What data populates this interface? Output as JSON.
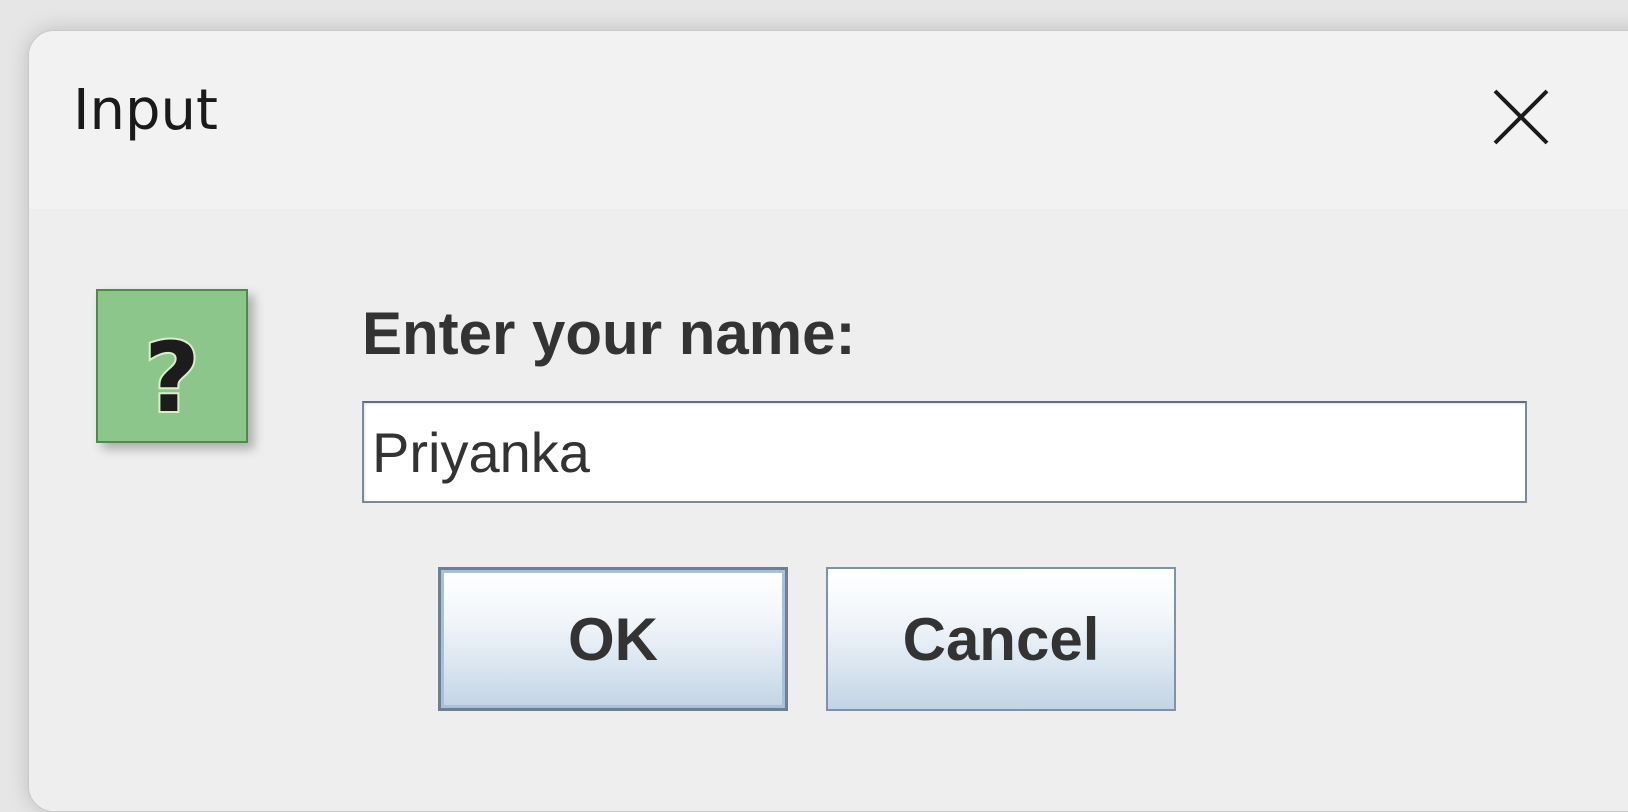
{
  "dialog": {
    "title": "Input",
    "close_icon": "close-icon",
    "message_icon": "question-icon",
    "prompt": "Enter your name:",
    "input_value": "Priyanka",
    "ok_label": "OK",
    "cancel_label": "Cancel"
  },
  "colors": {
    "icon_background": "#8cc68a",
    "icon_border": "#4e8b4a",
    "button_gradient_top": "#ffffff",
    "button_gradient_bottom": "#c3d4e4",
    "text": "#333333"
  }
}
